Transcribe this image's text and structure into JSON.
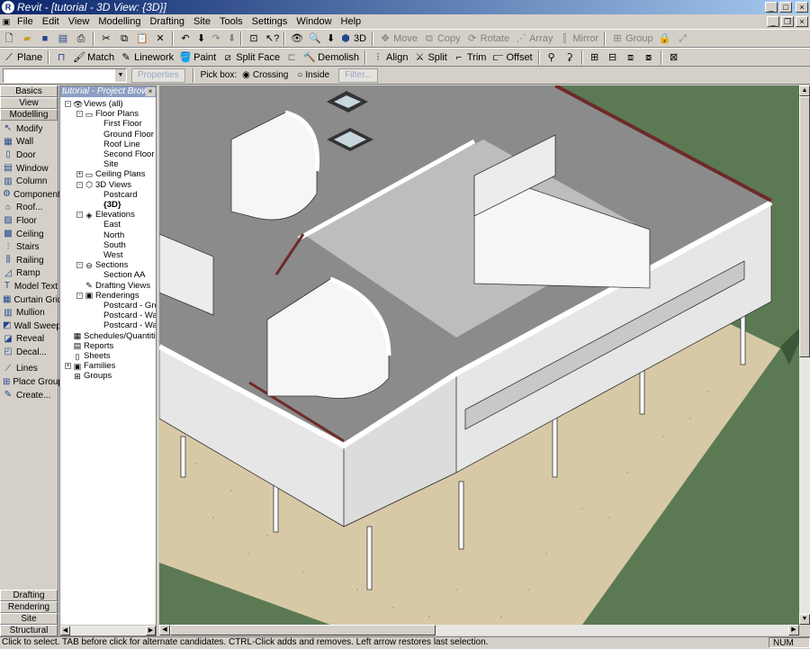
{
  "window": {
    "title": "Revit - [tutorial - 3D View: {3D}]"
  },
  "menu": [
    "File",
    "Edit",
    "View",
    "Modelling",
    "Drafting",
    "Site",
    "Tools",
    "Settings",
    "Window",
    "Help"
  ],
  "toolbar1": {
    "view_3d_label": "3D",
    "modify_tools": [
      {
        "label": "Move",
        "icon": "move-icon"
      },
      {
        "label": "Copy",
        "icon": "copy-icon"
      },
      {
        "label": "Rotate",
        "icon": "rotate-icon"
      },
      {
        "label": "Array",
        "icon": "array-icon"
      },
      {
        "label": "Mirror",
        "icon": "mirror-icon"
      },
      {
        "label": "Group",
        "icon": "group-icon"
      }
    ]
  },
  "toolbar2": {
    "tools": [
      {
        "label": "Plane",
        "icon": "plane-icon"
      },
      {
        "label": "Match",
        "icon": "match-icon"
      },
      {
        "label": "Linework",
        "icon": "linework-icon"
      },
      {
        "label": "Paint",
        "icon": "paint-icon"
      },
      {
        "label": "Split Face",
        "icon": "split-face-icon"
      },
      {
        "label": "Demolish",
        "icon": "demolish-icon"
      },
      {
        "label": "Align",
        "icon": "align-icon"
      },
      {
        "label": "Split",
        "icon": "split-icon"
      },
      {
        "label": "Trim",
        "icon": "trim-icon"
      },
      {
        "label": "Offset",
        "icon": "offset-icon"
      }
    ]
  },
  "options_bar": {
    "properties_label": "Properties",
    "pickbox_label": "Pick box:",
    "crossing_label": "Crossing",
    "inside_label": "Inside",
    "selected_pickbox": "Crossing",
    "filter_label": "Filter..."
  },
  "design_bar": {
    "top_tabs": [
      "Basics",
      "View",
      "Modelling"
    ],
    "active_tab": "Modelling",
    "items": [
      {
        "label": "Modify",
        "icon": "modify-arrow-icon"
      },
      {
        "label": "Wall",
        "icon": "wall-icon"
      },
      {
        "label": "Door",
        "icon": "door-icon"
      },
      {
        "label": "Window",
        "icon": "window-icon"
      },
      {
        "label": "Column",
        "icon": "column-icon"
      },
      {
        "label": "Component",
        "icon": "component-icon"
      },
      {
        "label": "Roof...",
        "icon": "roof-icon"
      },
      {
        "label": "Floor",
        "icon": "floor-icon"
      },
      {
        "label": "Ceiling",
        "icon": "ceiling-icon"
      },
      {
        "label": "Stairs",
        "icon": "stairs-icon"
      },
      {
        "label": "Railing",
        "icon": "railing-icon"
      },
      {
        "label": "Ramp",
        "icon": "ramp-icon"
      },
      {
        "label": "Model Text",
        "icon": "model-text-icon"
      },
      {
        "label": "Curtain Grid",
        "icon": "curtain-grid-icon"
      },
      {
        "label": "Mullion",
        "icon": "mullion-icon"
      },
      {
        "label": "Wall Sweep",
        "icon": "wall-sweep-icon"
      },
      {
        "label": "Reveal",
        "icon": "reveal-icon"
      },
      {
        "label": "Decal...",
        "icon": "decal-icon"
      },
      {
        "label": "Lines",
        "icon": "lines-icon"
      },
      {
        "label": "Place Group",
        "icon": "place-group-icon"
      },
      {
        "label": "Create...",
        "icon": "create-icon"
      }
    ],
    "bottom_tabs": [
      "Drafting",
      "Rendering",
      "Site",
      "Structural"
    ]
  },
  "project_browser": {
    "title": "tutorial - Project Browser",
    "rows": [
      {
        "label": "Views (all)",
        "level": 0,
        "toggle": "-",
        "icon": "eye-icon"
      },
      {
        "label": "Floor Plans",
        "level": 1,
        "toggle": "-",
        "icon": "floor-plan-icon"
      },
      {
        "label": "First Floor",
        "level": 2
      },
      {
        "label": "Ground Floor",
        "level": 2
      },
      {
        "label": "Roof Line",
        "level": 2
      },
      {
        "label": "Second Floor",
        "level": 2
      },
      {
        "label": "Site",
        "level": 2
      },
      {
        "label": "Ceiling Plans",
        "level": 1,
        "toggle": "+",
        "icon": "ceiling-plan-icon"
      },
      {
        "label": "3D Views",
        "level": 1,
        "toggle": "-",
        "icon": "3d-view-icon"
      },
      {
        "label": "Postcard",
        "level": 2
      },
      {
        "label": "{3D}",
        "level": 2,
        "bold": true
      },
      {
        "label": "Elevations",
        "level": 1,
        "toggle": "-",
        "icon": "elevation-icon"
      },
      {
        "label": "East",
        "level": 2
      },
      {
        "label": "North",
        "level": 2
      },
      {
        "label": "South",
        "level": 2
      },
      {
        "label": "West",
        "level": 2
      },
      {
        "label": "Sections",
        "level": 1,
        "toggle": "-",
        "icon": "section-icon"
      },
      {
        "label": "Section AA",
        "level": 2
      },
      {
        "label": "Drafting Views",
        "level": 1,
        "icon": "drafting-view-icon"
      },
      {
        "label": "Renderings",
        "level": 1,
        "toggle": "-",
        "icon": "rendering-icon"
      },
      {
        "label": "Postcard - Grou",
        "level": 2
      },
      {
        "label": "Postcard - Wall",
        "level": 2
      },
      {
        "label": "Postcard - Wall",
        "level": 2
      },
      {
        "label": "Schedules/Quantities",
        "level": 0,
        "icon": "schedule-icon"
      },
      {
        "label": "Reports",
        "level": 0,
        "icon": "report-icon"
      },
      {
        "label": "Sheets",
        "level": 0,
        "icon": "sheet-icon"
      },
      {
        "label": "Families",
        "level": 0,
        "toggle": "+",
        "icon": "family-icon"
      },
      {
        "label": "Groups",
        "level": 0,
        "icon": "group-icon"
      }
    ]
  },
  "status": {
    "message": "Click to select. TAB before click for alternate candidates. CTRL-Click adds and removes. Left arrow restores last selection.",
    "num": "NUM"
  },
  "colors": {
    "ground": "#5b7a54",
    "roof": "#8c8c8c",
    "wall": "#f4f4f4",
    "gravel": "#d8c8a8",
    "parapet_trim": "#6e2a2a"
  }
}
